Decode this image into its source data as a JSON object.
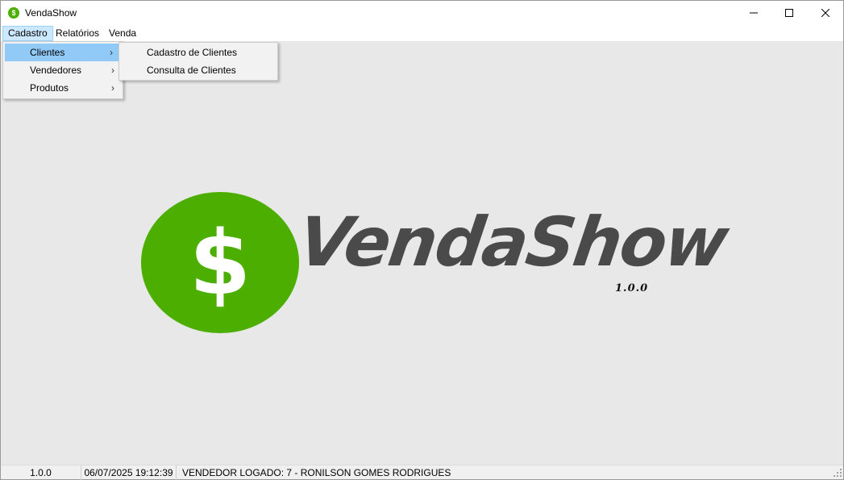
{
  "window": {
    "title": "VendaShow",
    "app_icon_glyph": "$",
    "controls": {
      "minimize": "minimize-icon",
      "maximize": "maximize-icon",
      "close": "close-icon"
    }
  },
  "menubar": {
    "items": [
      {
        "label": "Cadastro",
        "active": true
      },
      {
        "label": "Relatórios"
      },
      {
        "label": "Venda"
      }
    ]
  },
  "cadastro_menu": {
    "items": [
      {
        "label": "Clientes",
        "selected": true,
        "has_submenu": true
      },
      {
        "label": "Vendedores",
        "has_submenu": true
      },
      {
        "label": "Produtos",
        "has_submenu": true
      }
    ]
  },
  "clientes_submenu": {
    "items": [
      {
        "label": "Cadastro de Clientes"
      },
      {
        "label": "Consulta de Clientes"
      }
    ]
  },
  "logo": {
    "symbol": "$",
    "name": "VendaShow",
    "version": "1.0.0"
  },
  "statusbar": {
    "version": "1.0.0",
    "datetime": "06/07/2025 19:12:39",
    "user": "VENDEDOR LOGADO:  7 - RONILSON GOMES RODRIGUES"
  },
  "colors": {
    "brand_green": "#4caf00",
    "logo_text": "#4a4a4a",
    "menu_highlight": "#91c9f7",
    "client_area": "#e8e8e8"
  }
}
